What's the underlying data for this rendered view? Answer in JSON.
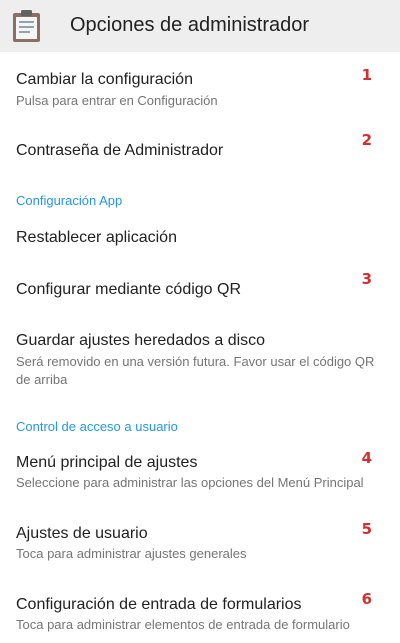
{
  "header": {
    "title": "Opciones de administrador",
    "icon": "clipboard-icon"
  },
  "sections": [
    {
      "label": "Configuración App"
    },
    {
      "label": "Control de acceso a usuario"
    }
  ],
  "items": [
    {
      "title": "Cambiar la configuración",
      "summary": "Pulsa para entrar en Configuración",
      "marker": "1"
    },
    {
      "title": "Contraseña de Administrador",
      "summary": "",
      "marker": "2"
    },
    {
      "title": "Restablecer aplicación",
      "summary": "",
      "marker": ""
    },
    {
      "title": "Configurar mediante código QR",
      "summary": "",
      "marker": "3"
    },
    {
      "title": "Guardar ajustes heredados a disco",
      "summary": "Será removido en una versión futura. Favor usar el código QR de arriba",
      "marker": ""
    },
    {
      "title": "Menú principal de ajustes",
      "summary": "Seleccione para administrar las opciones del Menú Principal",
      "marker": "4"
    },
    {
      "title": "Ajustes de usuario",
      "summary": "Toca para administrar ajustes generales",
      "marker": "5"
    },
    {
      "title": "Configuración de entrada de formularios",
      "summary": "Toca para administrar elementos de entrada de formulario",
      "marker": "6"
    }
  ],
  "colors": {
    "appbar": "#eeeeee",
    "section_header": "#2196f3",
    "marker": "#d32f2f",
    "summary": "#757575"
  }
}
